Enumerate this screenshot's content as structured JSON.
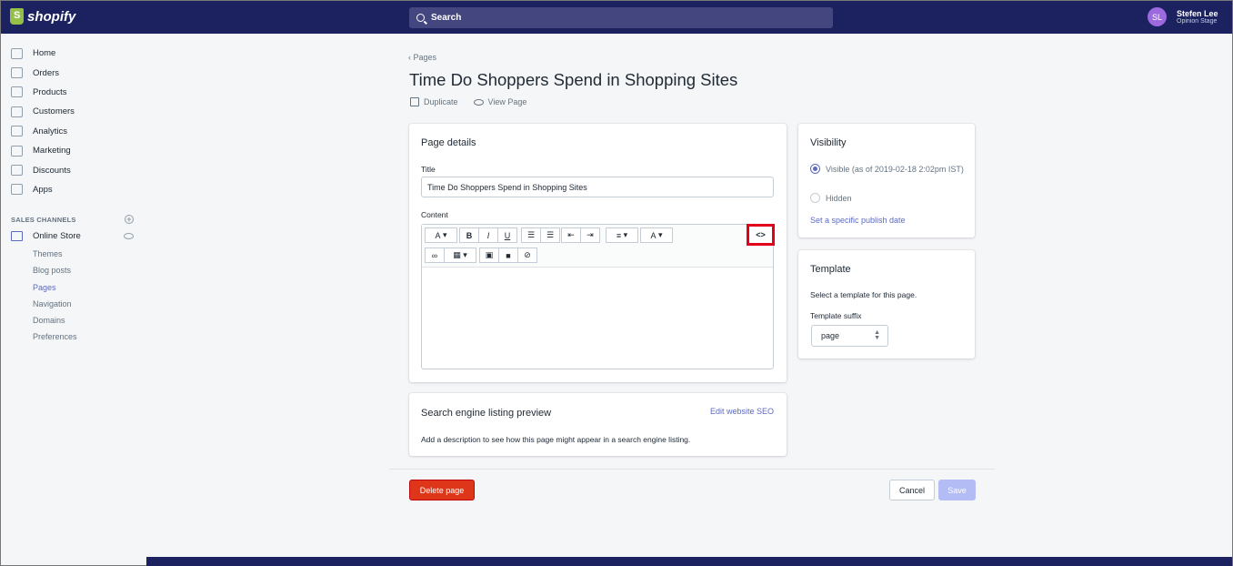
{
  "topbar": {
    "logo": "shopify",
    "search_placeholder": "Search",
    "user": {
      "initials": "SL",
      "name": "Stefen Lee",
      "store": "Opinion Stage"
    }
  },
  "sidebar": {
    "items": [
      {
        "label": "Home",
        "icon": "home-icon"
      },
      {
        "label": "Orders",
        "icon": "orders-icon"
      },
      {
        "label": "Products",
        "icon": "tag-icon"
      },
      {
        "label": "Customers",
        "icon": "person-icon"
      },
      {
        "label": "Analytics",
        "icon": "bar-chart-icon"
      },
      {
        "label": "Marketing",
        "icon": "megaphone-icon"
      },
      {
        "label": "Discounts",
        "icon": "discount-icon"
      },
      {
        "label": "Apps",
        "icon": "apps-icon"
      }
    ],
    "sales_channels_heading": "SALES CHANNELS",
    "online_store": "Online Store",
    "sub_items": [
      "Themes",
      "Blog posts",
      "Pages",
      "Navigation",
      "Domains",
      "Preferences"
    ],
    "active_sub": "Pages"
  },
  "page": {
    "breadcrumb": "Pages",
    "title": "Time Do Shoppers Spend in Shopping Sites",
    "duplicate": "Duplicate",
    "view_page": "View Page"
  },
  "details": {
    "heading": "Page details",
    "title_label": "Title",
    "title_value": "Time Do Shoppers Spend in Shopping Sites",
    "content_label": "Content",
    "toolbar": {
      "font": "A",
      "bold": "B",
      "italic": "I",
      "underline": "U",
      "code": "<>"
    }
  },
  "seo": {
    "heading": "Search engine listing preview",
    "edit_link": "Edit website SEO",
    "description": "Add a description to see how this page might appear in a search engine listing."
  },
  "visibility": {
    "heading": "Visibility",
    "visible_label": "Visible (as of 2019-02-18 2:02pm IST)",
    "hidden_label": "Hidden",
    "publish_link": "Set a specific publish date"
  },
  "template": {
    "heading": "Template",
    "description": "Select a template for this page.",
    "suffix_label": "Template suffix",
    "suffix_value": "page"
  },
  "footer": {
    "delete": "Delete page",
    "cancel": "Cancel",
    "save": "Save"
  },
  "colors": {
    "topbar": "#1c2260",
    "accent": "#5c6ac4",
    "danger": "#de3618",
    "highlight_box": "#e3001b"
  }
}
